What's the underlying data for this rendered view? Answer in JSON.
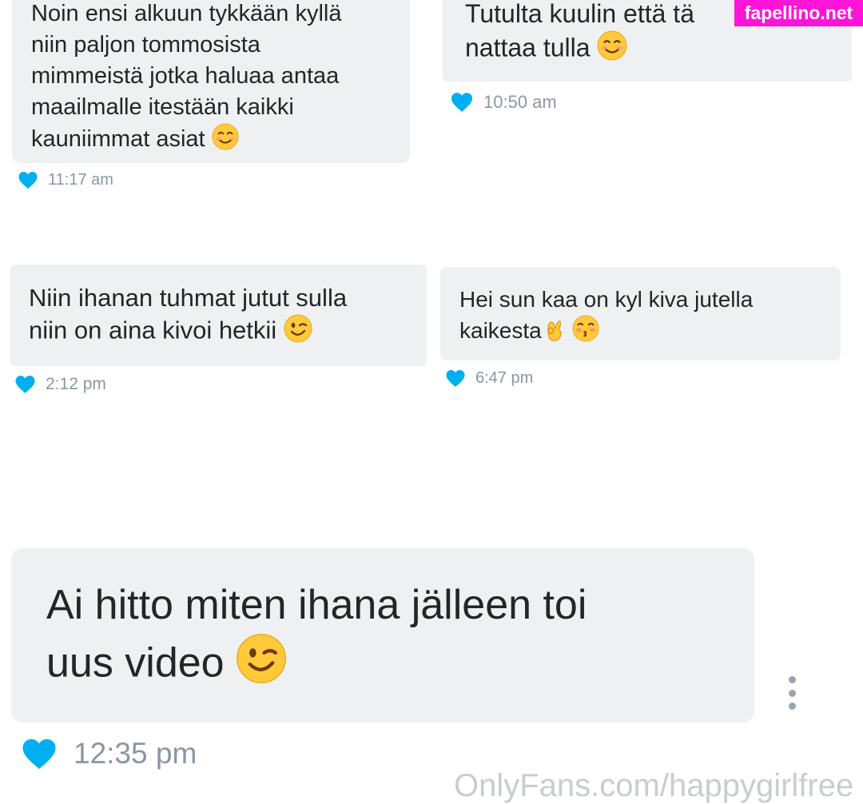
{
  "colors": {
    "bubble": "#eef0f1",
    "heart": "#00aff0",
    "timestamp": "#8a96a3",
    "text": "#242529",
    "watermark_badge": "#ff14d8"
  },
  "messages": [
    {
      "lines": [
        "Noin ensi alkuun tykkään kyllä",
        "niin paljon tommosista",
        "mimmeistä jotka haluaa antaa",
        "maailmalle itestään kaikki",
        "kauniimmat asiat"
      ],
      "emoji": "smiling-face-emoji",
      "time": "11:17 am"
    },
    {
      "lines": [
        "Tutulta kuulin että tä",
        "nattaa tulla"
      ],
      "emoji": "smiling-face-emoji",
      "time": "10:50 am"
    },
    {
      "lines": [
        "Niin ihanan tuhmat jutut sulla",
        "niin on aina kivoi hetkii"
      ],
      "emoji": "winking-face-emoji",
      "time": "2:12 pm"
    },
    {
      "lines": [
        "Hei sun kaa on kyl kiva jutella",
        "kaikesta"
      ],
      "emoji": "ok-hand-and-kissing-face-emoji",
      "time": "6:47 pm"
    },
    {
      "lines": [
        "Ai hitto miten ihana jälleen toi",
        "uus video"
      ],
      "emoji": "winking-face-emoji",
      "time": "12:35 pm"
    }
  ],
  "watermarks": {
    "top": "fapellino.net",
    "bottom": "OnlyFans.com/happygirlfree"
  }
}
